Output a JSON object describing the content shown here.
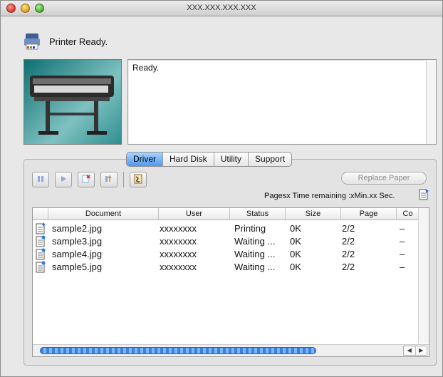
{
  "window": {
    "title": "XXX.XXX.XXX.XXX"
  },
  "status": {
    "text": "Printer Ready.",
    "icon": "printer-icon"
  },
  "message": {
    "text": "Ready."
  },
  "tabs": [
    {
      "label": "Driver",
      "active": true
    },
    {
      "label": "Hard Disk",
      "active": false
    },
    {
      "label": "Utility",
      "active": false
    },
    {
      "label": "Support",
      "active": false
    }
  ],
  "toolbar": {
    "buttons": [
      "pause-icon",
      "resume-icon",
      "delete-job-icon",
      "move-job-icon",
      "special-settings-icon"
    ]
  },
  "replace_paper": {
    "label": "Replace Paper"
  },
  "time_remaining": "Pagesx Time remaining :xMin.xx Sec.",
  "table": {
    "columns": [
      "Document",
      "User",
      "Status",
      "Size",
      "Page",
      "Co"
    ],
    "rows": [
      {
        "document": "sample2.jpg",
        "user": "xxxxxxxx",
        "status": "Printing",
        "size": "0K",
        "page": "2/2",
        "copies": "–"
      },
      {
        "document": "sample3.jpg",
        "user": "xxxxxxxx",
        "status": "Waiting ...",
        "size": "0K",
        "page": "2/2",
        "copies": "–"
      },
      {
        "document": "sample4.jpg",
        "user": "xxxxxxxx",
        "status": "Waiting ...",
        "size": "0K",
        "page": "2/2",
        "copies": "–"
      },
      {
        "document": "sample5.jpg",
        "user": "xxxxxxxx",
        "status": "Waiting ...",
        "size": "0K",
        "page": "2/2",
        "copies": "–"
      }
    ]
  },
  "colors": {
    "tab_active": "#4d9bf0",
    "scroll_thumb": "#3b82df"
  }
}
